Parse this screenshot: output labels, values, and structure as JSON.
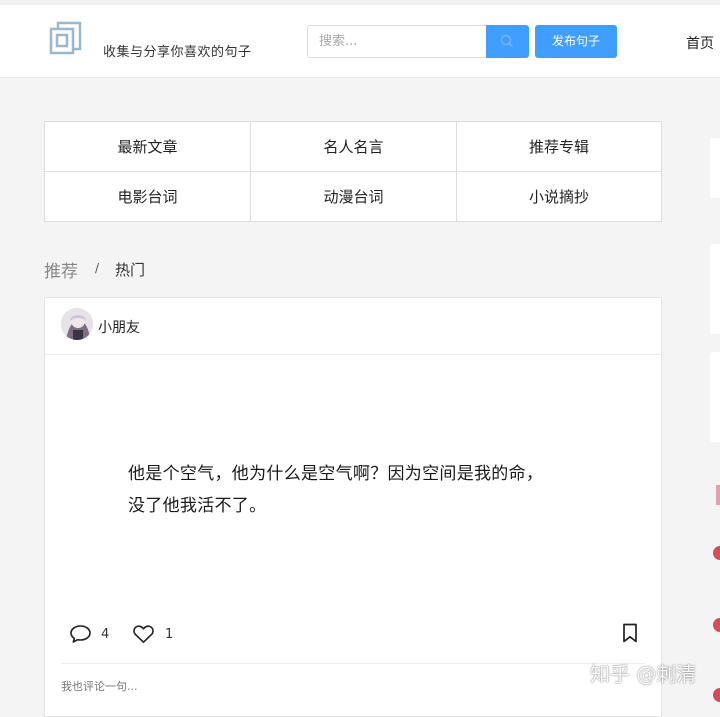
{
  "header": {
    "tagline": "收集与分享你喜欢的句子",
    "search": {
      "placeholder": "搜索...",
      "value": ""
    },
    "publish_label": "发布句子",
    "nav_home": "首页"
  },
  "categories": [
    {
      "label": "最新文章"
    },
    {
      "label": "名人名言"
    },
    {
      "label": "推荐专辑"
    },
    {
      "label": "电影台词"
    },
    {
      "label": "动漫台词"
    },
    {
      "label": "小说摘抄"
    }
  ],
  "tabs": {
    "recommended": "推荐",
    "separator": "/",
    "hot": "热门"
  },
  "post": {
    "author": "小朋友",
    "text_line1": "他是个空气，他为什么是空气啊？因为空间是我的命，",
    "text_line2": "没了他我活不了。",
    "comment_count": "4",
    "like_count": "1",
    "comment_placeholder": "我也评论一句..."
  },
  "watermark": "知乎 @刺清",
  "colors": {
    "accent": "#409eff",
    "background": "#f4f4f4",
    "card": "#ffffff",
    "border": "#dcdcdc"
  }
}
